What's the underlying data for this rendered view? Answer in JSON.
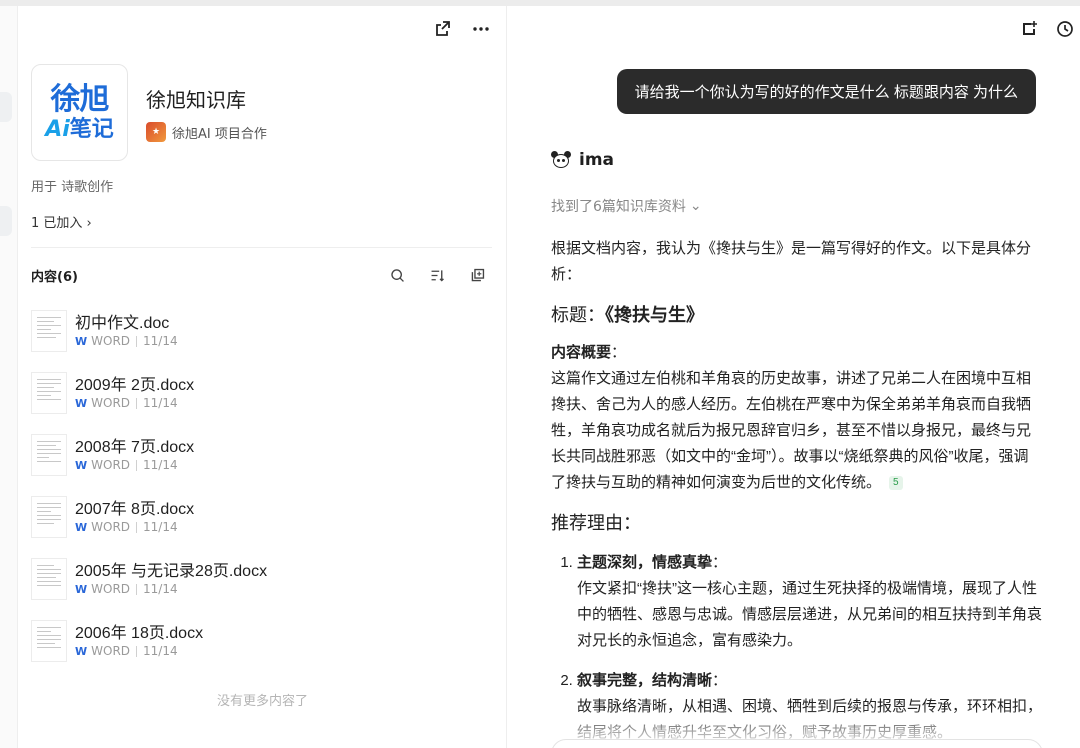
{
  "kb": {
    "logo_line1": "徐旭",
    "logo_ai": "Ai",
    "logo_line2": "笔记",
    "title": "徐旭知识库",
    "owner": "徐旭AI 项目合作",
    "usage": "用于 诗歌创作",
    "joined": "1 已加入",
    "content_head": "内容(6)",
    "no_more": "没有更多内容了",
    "docs": [
      {
        "name": "初中作文.doc",
        "type": "WORD",
        "date": "11/14"
      },
      {
        "name": "2009年 2页.docx",
        "type": "WORD",
        "date": "11/14"
      },
      {
        "name": "2008年 7页.docx",
        "type": "WORD",
        "date": "11/14"
      },
      {
        "name": "2007年 8页.docx",
        "type": "WORD",
        "date": "11/14"
      },
      {
        "name": "2005年 与无记录28页.docx",
        "type": "WORD",
        "date": "11/14"
      },
      {
        "name": "2006年 18页.docx",
        "type": "WORD",
        "date": "11/14"
      }
    ]
  },
  "chat": {
    "user_message": "请给我一个你认为写的好的作文是什么 标题跟内容  为什么",
    "assistant_name": "ima",
    "found": "找到了6篇知识库资料",
    "intro": "根据文档内容，我认为《搀扶与生》是一篇写得好的作文。以下是具体分析：",
    "title_label": "标题：",
    "title_value": "《搀扶与生》",
    "summary_label": "内容概要",
    "summary": "这篇作文通过左伯桃和羊角哀的历史故事，讲述了兄弟二人在困境中互相搀扶、舍己为人的感人经历。左伯桃在严寒中为保全弟弟羊角哀而自我牺牲，羊角哀功成名就后为报兄恩辞官归乡，甚至不惜以身报兄，最终与兄长共同战胜邪恶（如文中的“金坷”）。故事以“烧纸祭典的风俗”收尾，强调了搀扶与互助的精神如何演变为后世的文化传统。",
    "cite": "5",
    "reasons_head": "推荐理由：",
    "reasons": [
      {
        "title": "主题深刻，情感真挚",
        "body": "作文紧扣“搀扶”这一核心主题，通过生死抉择的极端情境，展现了人性中的牺牲、感恩与忠诚。情感层层递进，从兄弟间的相互扶持到羊角哀对兄长的永恒追念，富有感染力。"
      },
      {
        "title": "叙事完整，结构清晰",
        "body": "故事脉络清晰，从相遇、困境、牺牲到后续的报恩与传承，环环相扣，结尾将个人情感升华至文化习俗，赋予故事历史厚重感。"
      }
    ]
  }
}
